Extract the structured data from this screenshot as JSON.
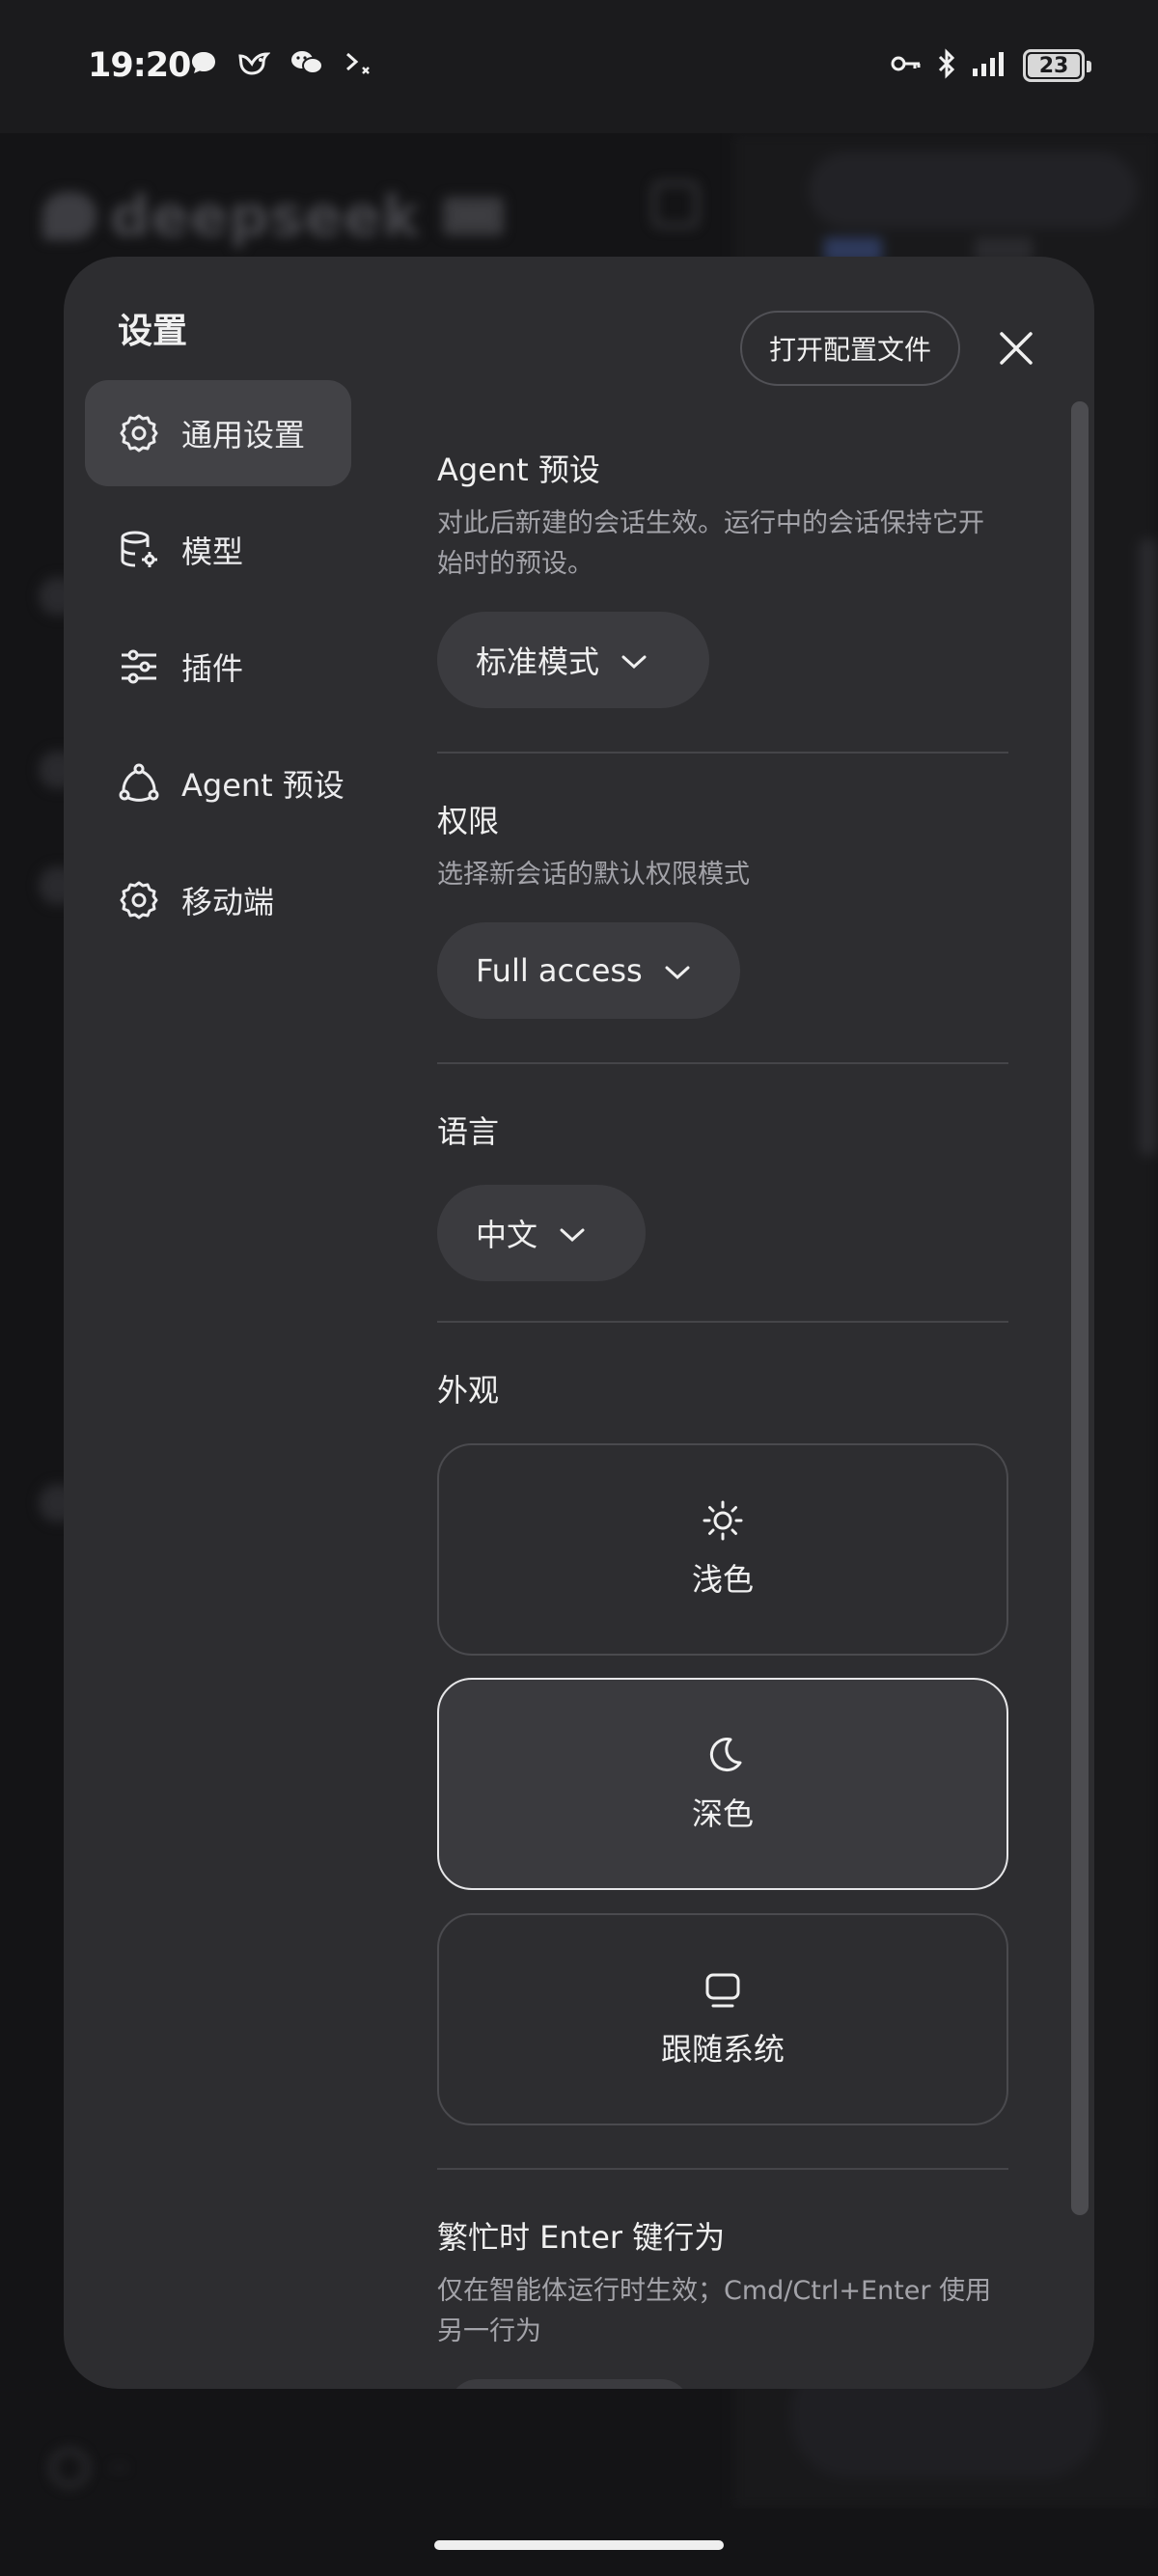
{
  "status_bar": {
    "time": "19:20",
    "left_icons": [
      "chat-bubble-icon",
      "bird-app-icon",
      "wechat-icon",
      "terminal-icon"
    ],
    "right_icons": [
      "key-icon",
      "bluetooth-icon",
      "signal-icon"
    ],
    "battery": "23"
  },
  "background_app": {
    "logo_text": "deepseek"
  },
  "settings": {
    "title": "设置",
    "open_config_label": "打开配置文件",
    "nav": [
      {
        "label": "通用设置",
        "icon": "gear-icon"
      },
      {
        "label": "模型",
        "icon": "database-gear-icon"
      },
      {
        "label": "插件",
        "icon": "sliders-icon"
      },
      {
        "label": "Agent 预设",
        "icon": "nodes-icon"
      },
      {
        "label": "移动端",
        "icon": "gear-icon"
      }
    ],
    "active_nav": "通用设置",
    "agent_preset": {
      "title": "Agent 预设",
      "description": "对此后新建的会话生效。运行中的会话保持它开始时的预设。",
      "value": "标准模式"
    },
    "permissions": {
      "title": "权限",
      "description": "选择新会话的默认权限模式",
      "value": "Full access"
    },
    "language": {
      "title": "语言",
      "value": "中文"
    },
    "appearance": {
      "title": "外观",
      "options": [
        {
          "label": "浅色",
          "icon": "sun-icon"
        },
        {
          "label": "深色",
          "icon": "moon-icon"
        },
        {
          "label": "跟随系统",
          "icon": "monitor-icon"
        }
      ],
      "selected": "深色"
    },
    "busy_enter": {
      "title": "繁忙时 Enter 键行为",
      "description": "仅在智能体运行时生效；Cmd/Ctrl+Enter 使用另一行为"
    }
  }
}
